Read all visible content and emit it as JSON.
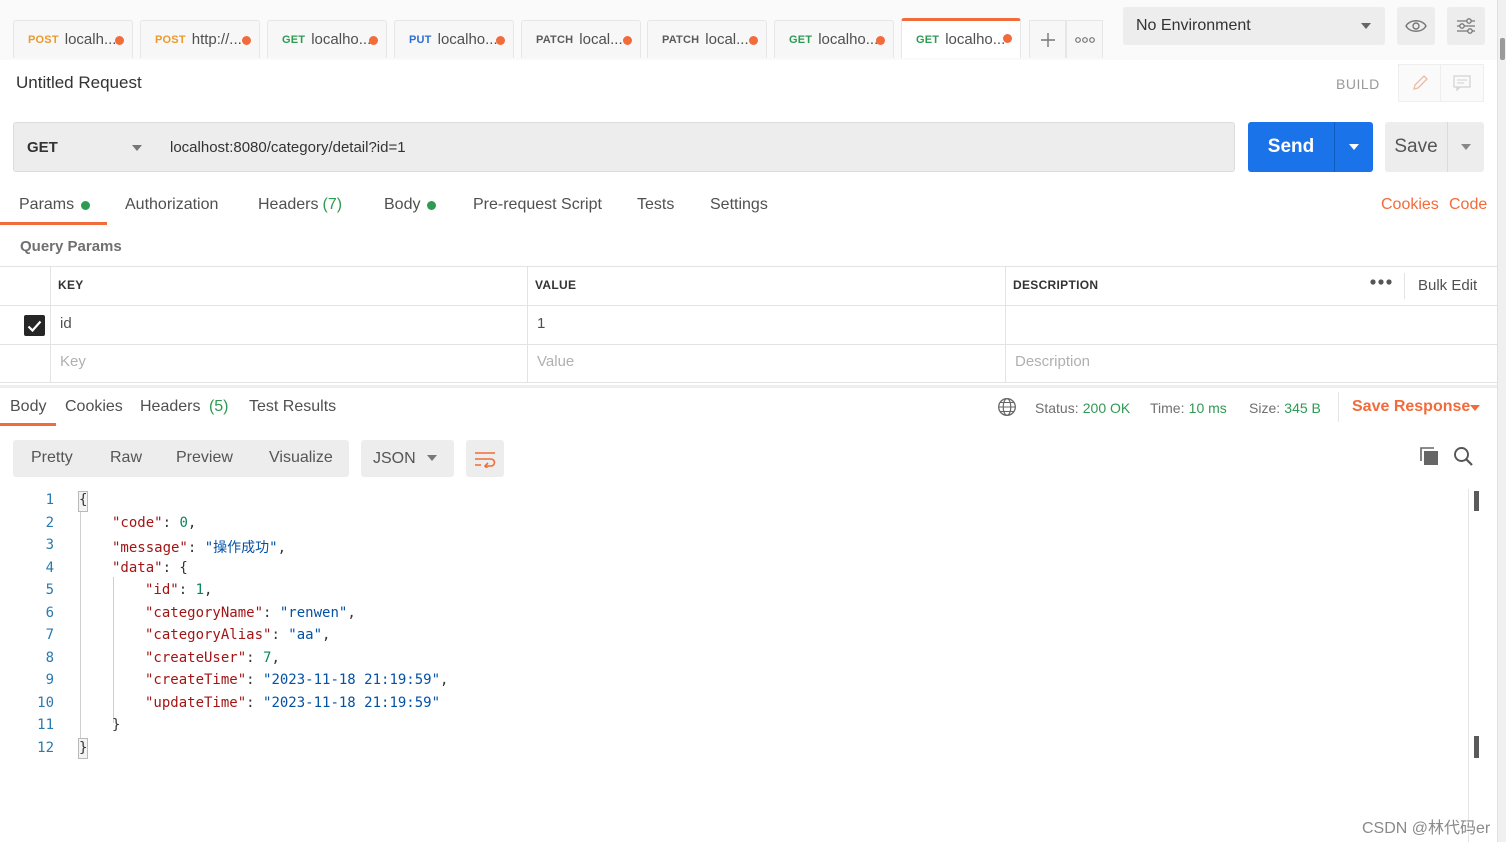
{
  "tabs": [
    {
      "method": "POST",
      "url": "localh..."
    },
    {
      "method": "POST",
      "url": "http://..."
    },
    {
      "method": "GET",
      "url": "localho..."
    },
    {
      "method": "PUT",
      "url": "localho..."
    },
    {
      "method": "PATCH",
      "url": "local..."
    },
    {
      "method": "PATCH",
      "url": "local..."
    },
    {
      "method": "GET",
      "url": "localho..."
    },
    {
      "method": "GET",
      "url": "localho..."
    }
  ],
  "environment": {
    "selected": "No Environment"
  },
  "request": {
    "title": "Untitled Request",
    "mode": "BUILD",
    "method": "GET",
    "url": "localhost:8080/category/detail?id=1",
    "send_label": "Send",
    "save_label": "Save"
  },
  "request_tabs": {
    "params": "Params",
    "authorization": "Authorization",
    "headers": "Headers",
    "headers_count": "(7)",
    "body": "Body",
    "prerequest": "Pre-request Script",
    "tests": "Tests",
    "settings": "Settings",
    "cookies": "Cookies",
    "code": "Code"
  },
  "query_params": {
    "title": "Query Params",
    "columns": {
      "key": "KEY",
      "value": "VALUE",
      "description": "DESCRIPTION"
    },
    "bulk_edit": "Bulk Edit",
    "rows": [
      {
        "checked": true,
        "key": "id",
        "value": "1",
        "description": ""
      }
    ],
    "placeholders": {
      "key": "Key",
      "value": "Value",
      "description": "Description"
    }
  },
  "response": {
    "tabs": {
      "body": "Body",
      "cookies": "Cookies",
      "headers": "Headers",
      "headers_count": "(5)",
      "test_results": "Test Results"
    },
    "status_label": "Status:",
    "status_value": "200 OK",
    "time_label": "Time:",
    "time_value": "10 ms",
    "size_label": "Size:",
    "size_value": "345 B",
    "save_response": "Save Response",
    "formats": {
      "pretty": "Pretty",
      "raw": "Raw",
      "preview": "Preview",
      "visualize": "Visualize"
    },
    "language": "JSON",
    "line_numbers": [
      "1",
      "2",
      "3",
      "4",
      "5",
      "6",
      "7",
      "8",
      "9",
      "10",
      "11",
      "12"
    ],
    "json": {
      "open": "{",
      "code_key": "\"code\"",
      "code_val": "0",
      "message_key": "\"message\"",
      "message_val": "\"操作成功\"",
      "data_key": "\"data\"",
      "id_key": "\"id\"",
      "id_val": "1",
      "categoryName_key": "\"categoryName\"",
      "categoryName_val": "\"renwen\"",
      "categoryAlias_key": "\"categoryAlias\"",
      "categoryAlias_val": "\"aa\"",
      "createUser_key": "\"createUser\"",
      "createUser_val": "7",
      "createTime_key": "\"createTime\"",
      "createTime_val": "\"2023-11-18 21:19:59\"",
      "updateTime_key": "\"updateTime\"",
      "updateTime_val": "\"2023-11-18 21:19:59\"",
      "close_inner": "}",
      "close": "}"
    }
  },
  "watermark": "CSDN @林代码er",
  "colors": {
    "accent": "#f26b3a",
    "send": "#1a73e8",
    "success": "#2e9a52",
    "post": "#ea9a2e",
    "put": "#2f6ed4"
  }
}
